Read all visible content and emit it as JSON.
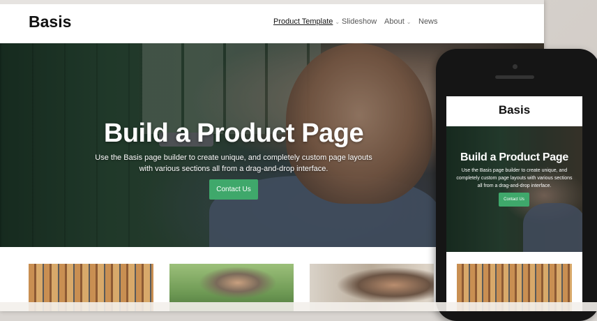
{
  "site": {
    "logo": "Basis",
    "nav": [
      {
        "label": "Product Template",
        "dropdown": true,
        "active": true
      },
      {
        "label": "Slideshow",
        "dropdown": false,
        "active": false
      },
      {
        "label": "About",
        "dropdown": true,
        "active": false
      },
      {
        "label": "News",
        "dropdown": false,
        "active": false
      }
    ]
  },
  "hero": {
    "title": "Build a Product Page",
    "subtitle": "Use the Basis page builder to create unique, and completely custom page layouts with various sections all from a drag-and-drop interface.",
    "button_label": "Contact Us"
  },
  "mobile": {
    "logo": "Basis",
    "title": "Build a Product Page",
    "subtitle": "Use the Basis page builder to create unique, and completely custom page layouts with various sections all from a drag-and-drop interface.",
    "button_label": "Contact Us"
  },
  "colors": {
    "accent": "#3fa86b",
    "text": "#111111",
    "nav_text": "#555555"
  },
  "icons": {
    "dropdown": "chevron-down-icon"
  }
}
